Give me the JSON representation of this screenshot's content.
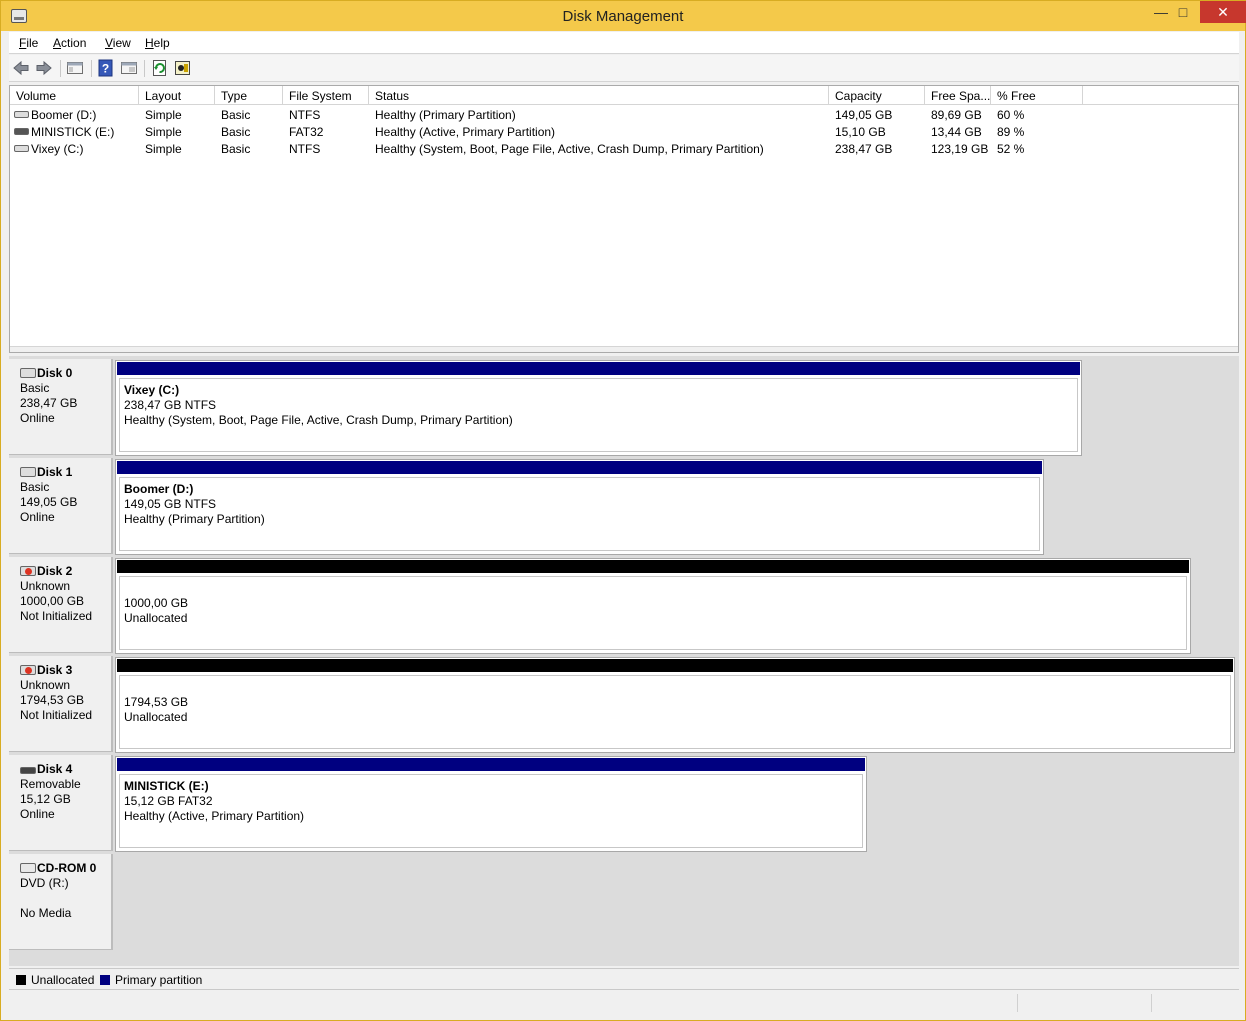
{
  "window": {
    "title": "Disk Management"
  },
  "colors": {
    "primary_partition": "#000080",
    "unallocated": "#000000"
  },
  "menu": [
    {
      "label": "File",
      "mnemonic": "F",
      "rest": "ile"
    },
    {
      "label": "Action",
      "mnemonic": "A",
      "rest": "ction"
    },
    {
      "label": "View",
      "mnemonic": "V",
      "rest": "iew"
    },
    {
      "label": "Help",
      "mnemonic": "H",
      "rest": "elp"
    }
  ],
  "toolbar": [
    {
      "icon": "back-arrow-icon"
    },
    {
      "icon": "forward-arrow-icon"
    },
    {
      "icon": "show-hide-tree-icon"
    },
    {
      "icon": "help-icon"
    },
    {
      "icon": "properties-icon"
    },
    {
      "icon": "refresh-icon"
    },
    {
      "icon": "rescan-disks-icon"
    }
  ],
  "volume_table": {
    "columns": [
      "Volume",
      "Layout",
      "Type",
      "File System",
      "Status",
      "Capacity",
      "Free Spa...",
      "% Free"
    ],
    "rows": [
      {
        "volume": "Boomer (D:)",
        "layout": "Simple",
        "type": "Basic",
        "fs": "NTFS",
        "status": "Healthy (Primary Partition)",
        "capacity": "149,05 GB",
        "free": "89,69 GB",
        "pct": "60 %",
        "icon": "disk-drive-icon"
      },
      {
        "volume": "MINISTICK (E:)",
        "layout": "Simple",
        "type": "Basic",
        "fs": "FAT32",
        "status": "Healthy (Active, Primary Partition)",
        "capacity": "15,10 GB",
        "free": "13,44 GB",
        "pct": "89 %",
        "icon": "removable-drive-icon"
      },
      {
        "volume": "Vixey (C:)",
        "layout": "Simple",
        "type": "Basic",
        "fs": "NTFS",
        "status": "Healthy (System, Boot, Page File, Active, Crash Dump, Primary Partition)",
        "capacity": "238,47 GB",
        "free": "123,19 GB",
        "pct": "52 %",
        "icon": "disk-drive-icon"
      }
    ]
  },
  "disks": [
    {
      "name": "Disk 0",
      "kind": "Basic",
      "size": "238,47 GB",
      "state": "Online",
      "icon": "disk-icon",
      "partition": {
        "type": "primary",
        "name": "Vixey  (C:)",
        "detail": "238,47 GB NTFS",
        "status": "Healthy (System, Boot, Page File, Active, Crash Dump, Primary Partition)"
      }
    },
    {
      "name": "Disk 1",
      "kind": "Basic",
      "size": "149,05 GB",
      "state": "Online",
      "icon": "disk-icon",
      "partition": {
        "type": "primary",
        "name": "Boomer  (D:)",
        "detail": "149,05 GB NTFS",
        "status": "Healthy (Primary Partition)"
      }
    },
    {
      "name": "Disk 2",
      "kind": "Unknown",
      "size": "1000,00 GB",
      "state": "Not Initialized",
      "icon": "disk-warning-icon",
      "partition": {
        "type": "unallocated",
        "name": "",
        "detail": "1000,00 GB",
        "status": "Unallocated"
      }
    },
    {
      "name": "Disk 3",
      "kind": "Unknown",
      "size": "1794,53 GB",
      "state": "Not Initialized",
      "icon": "disk-warning-icon",
      "partition": {
        "type": "unallocated",
        "name": "",
        "detail": "1794,53 GB",
        "status": "Unallocated"
      }
    },
    {
      "name": "Disk 4",
      "kind": "Removable",
      "size": "15,12 GB",
      "state": "Online",
      "icon": "removable-disk-icon",
      "partition": {
        "type": "primary",
        "name": "MINISTICK  (E:)",
        "detail": "15,12 GB FAT32",
        "status": "Healthy (Active, Primary Partition)"
      }
    },
    {
      "name": "CD-ROM 0",
      "kind": "DVD (R:)",
      "size": "",
      "state": "No Media",
      "icon": "cdrom-icon",
      "partition": null
    }
  ],
  "legend": [
    {
      "label": "Unallocated",
      "color": "#000000"
    },
    {
      "label": "Primary partition",
      "color": "#000080"
    }
  ]
}
